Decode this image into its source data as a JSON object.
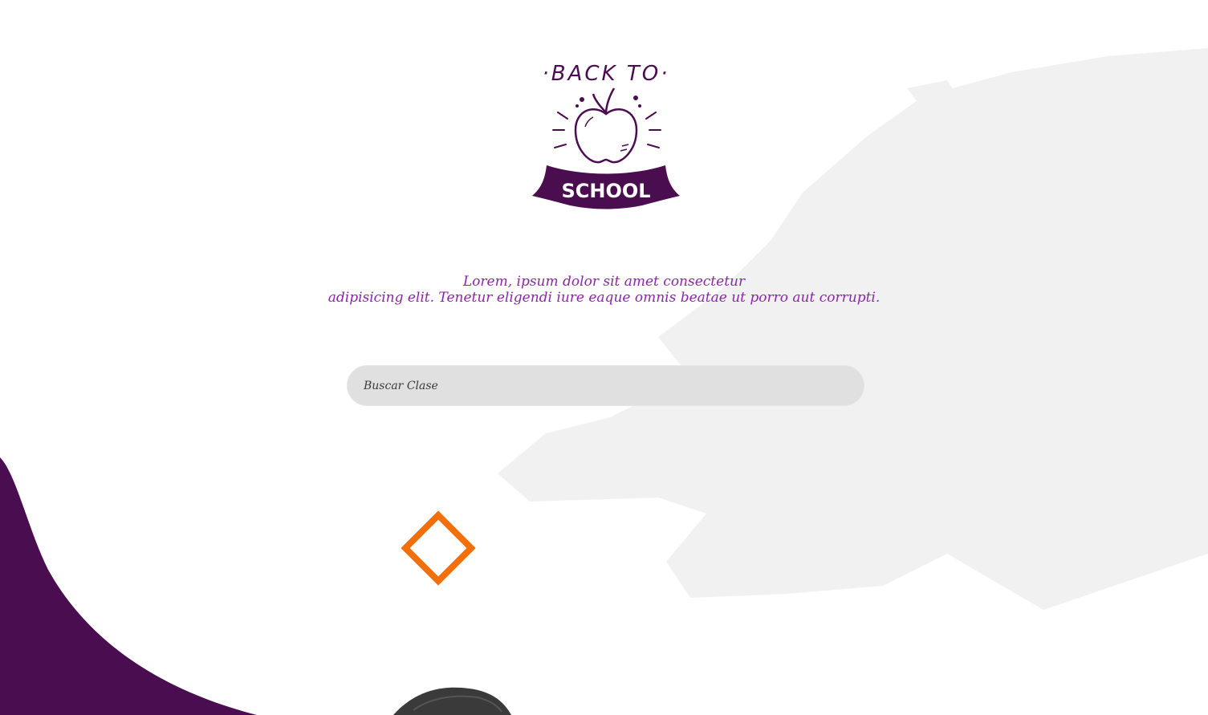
{
  "logo": {
    "top_text": "·BACK TO·",
    "banner_text": "SCHOOL",
    "icon": "apple-icon",
    "color": "#4a0d4f"
  },
  "hero": {
    "tagline_line1": "Lorem, ipsum dolor sit amet consectetur",
    "tagline_line2": "adipisicing elit. Tenetur eligendi iure eaque omnis beatae ut porro aut corrupti.",
    "tagline_color": "#8e24aa"
  },
  "search": {
    "placeholder": "Buscar Clase",
    "value": ""
  },
  "decor": {
    "diamond_color": "#f36f0c",
    "wave_color": "#4a0d4f",
    "brush_color": "#efefef"
  }
}
